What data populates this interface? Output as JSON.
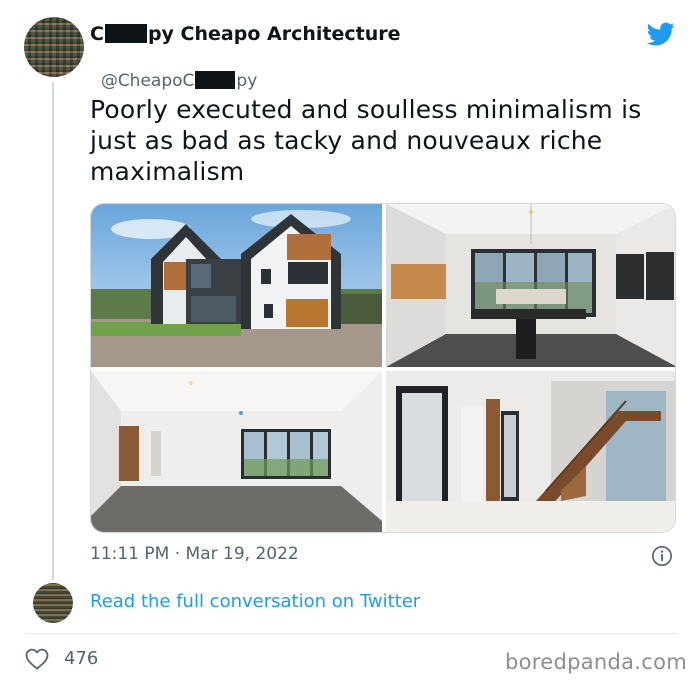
{
  "tweet": {
    "author_name_parts": [
      "C",
      "py Cheapo Architecture"
    ],
    "handle_parts": [
      "@CheapoC",
      "py"
    ],
    "text_lines": [
      "Poorly executed and soulless minimalism  is",
      "just as bad as tacky and nouveaux riche",
      "maximalism"
    ],
    "timestamp": "11:11 PM · Mar 19, 2022",
    "likes": "476",
    "read_more": "Read the full conversation on Twitter"
  },
  "media": [
    {
      "alt": "exterior-house-photo"
    },
    {
      "alt": "kitchen-photo"
    },
    {
      "alt": "empty-living-room-photo"
    },
    {
      "alt": "hallway-staircase-photo"
    }
  ],
  "icons": {
    "twitter": "twitter-bird-icon",
    "info": "info-icon",
    "like": "heart-icon"
  },
  "colors": {
    "accent": "#1d9bf0",
    "text": "#0f1419",
    "secondary": "#536471"
  },
  "watermark": "boredpanda.com"
}
